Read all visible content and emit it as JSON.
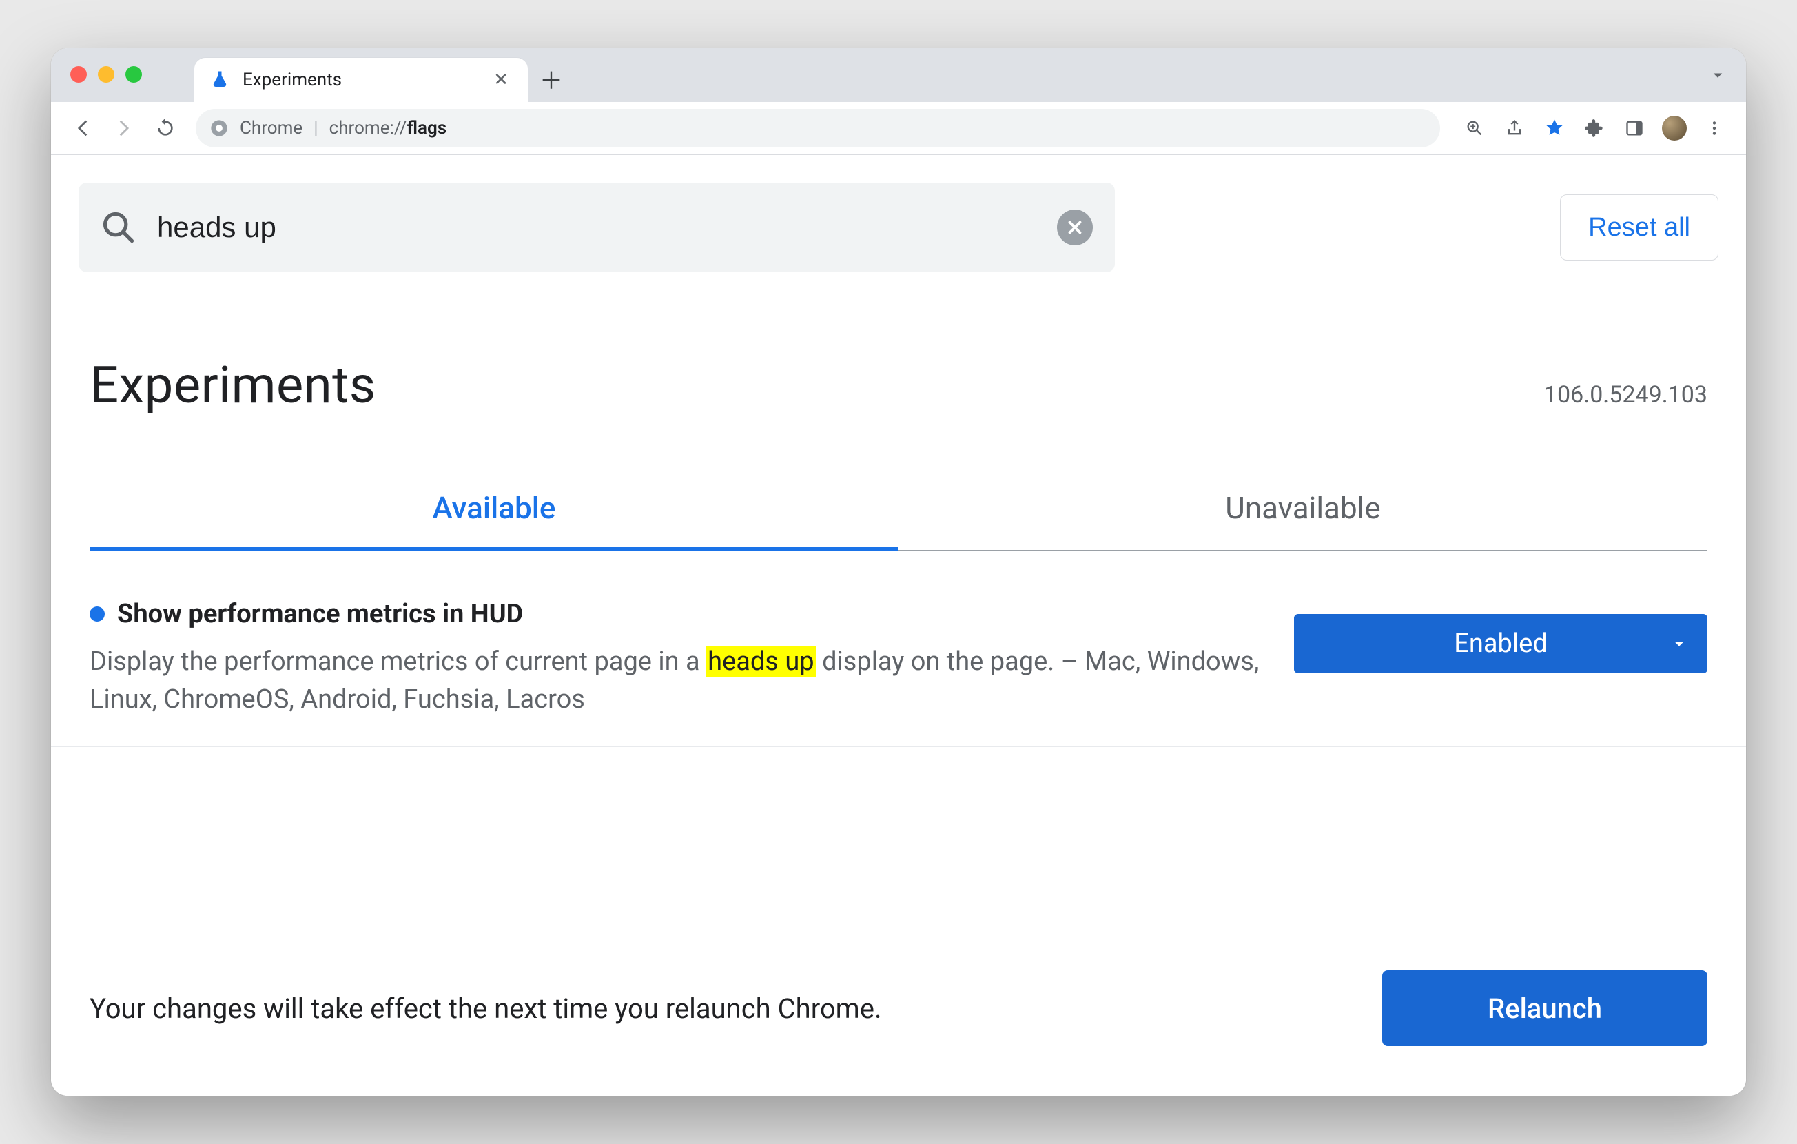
{
  "window": {
    "tab_title": "Experiments"
  },
  "toolbar": {
    "url_label": "Chrome",
    "url_scheme": "chrome://",
    "url_path": "flags"
  },
  "search": {
    "value": "heads up"
  },
  "reset_label": "Reset all",
  "page_title": "Experiments",
  "version": "106.0.5249.103",
  "tabs": {
    "available": "Available",
    "unavailable": "Unavailable"
  },
  "flag": {
    "title": "Show performance metrics in HUD",
    "desc_before": "Display the performance metrics of current page in a ",
    "desc_highlight": "heads up",
    "desc_after": " display on the page. – Mac, Windows, Linux, ChromeOS, Android, Fuchsia, Lacros",
    "select_value": "Enabled"
  },
  "footer": {
    "message": "Your changes will take effect the next time you relaunch Chrome.",
    "relaunch": "Relaunch"
  }
}
